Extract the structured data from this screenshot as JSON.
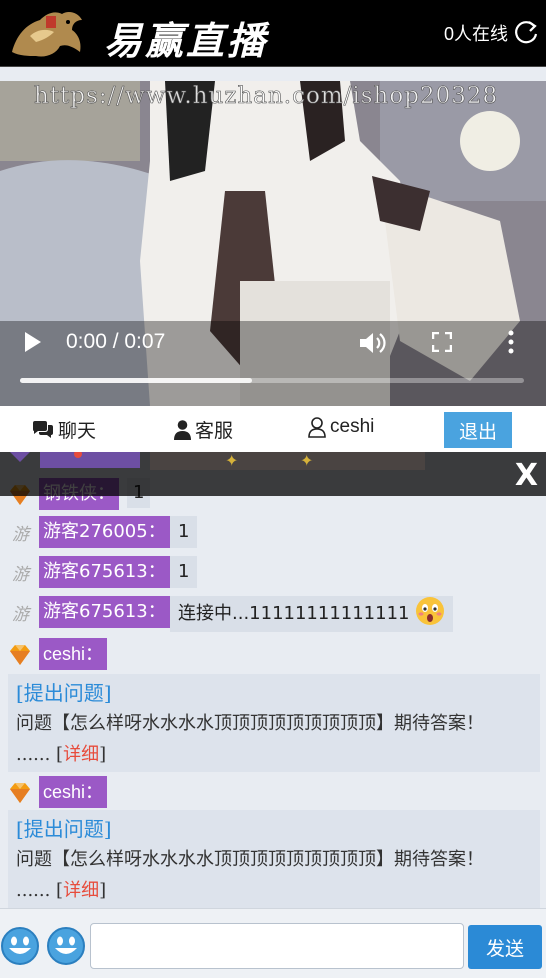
{
  "header": {
    "brand": "易赢直播",
    "online": "0人在线",
    "logo_icon": "dragon-logo-icon",
    "refresh_icon": "refresh-icon"
  },
  "video": {
    "watermark": "https://www.huzhan.com/ishop20328",
    "time": "0:00 / 0:07",
    "progress": 0.46
  },
  "tabs": {
    "chat": "聊天",
    "service": "客服",
    "user": "ceshi",
    "logout": "退出"
  },
  "chat": {
    "close": "X",
    "messages": [
      {
        "badge": "diamond",
        "name": "钢铁侠：",
        "text": "1"
      },
      {
        "badge": "guest",
        "badge_text": "游",
        "name": "游客276005：",
        "text": "1"
      },
      {
        "badge": "guest",
        "badge_text": "游",
        "name": "游客675613：",
        "text": "1"
      },
      {
        "badge": "guest",
        "badge_text": "游",
        "name": "游客675613：",
        "text": "连接中...11111111111111"
      },
      {
        "badge": "diamond",
        "name": "ceshi："
      },
      {
        "badge": "diamond",
        "name": "ceshi："
      }
    ],
    "questions": [
      {
        "link": "[提出问题]",
        "body": "问题【怎么样呀水水水水顶顶顶顶顶顶顶顶顶】期待答案！",
        "more_prefix": "...... [",
        "detail": "详细",
        "more_suffix": "]"
      },
      {
        "link": "[提出问题]",
        "body": "问题【怎么样呀水水水水顶顶顶顶顶顶顶顶顶】期待答案！",
        "more_prefix": "...... [",
        "detail": "详细",
        "more_suffix": "]"
      }
    ]
  },
  "input": {
    "value": "",
    "placeholder": "",
    "send": "发送"
  },
  "colors": {
    "accent": "#4aa3df",
    "send": "#2b8ad6",
    "name_bg": "#9b59c6",
    "link": "#2b8bd8",
    "detail": "#e74c3c"
  }
}
